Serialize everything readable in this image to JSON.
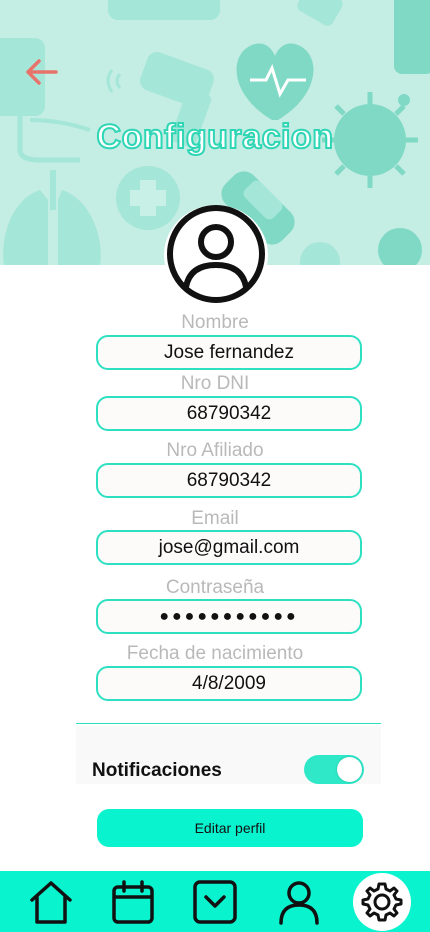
{
  "header": {
    "title": "Configuracion"
  },
  "form": {
    "fields": [
      {
        "label": "Nombre",
        "value": "Jose fernandez"
      },
      {
        "label": "Nro DNI",
        "value": "68790342"
      },
      {
        "label": "Nro Afiliado",
        "value": "68790342"
      },
      {
        "label": "Email",
        "value": "jose@gmail.com"
      },
      {
        "label": "Contraseña",
        "value": "●●●●●●●●●●●"
      },
      {
        "label": "Fecha de nacimiento",
        "value": "4/8/2009"
      }
    ]
  },
  "notifications": {
    "label": "Notificaciones",
    "enabled": true
  },
  "actions": {
    "edit_label": "Editar perfil"
  },
  "nav": {
    "items": [
      "home-icon",
      "calendar-icon",
      "inbox-icon",
      "profile-icon",
      "settings-icon"
    ],
    "active": "settings-icon"
  },
  "colors": {
    "accent": "#0af3cf",
    "border": "#2de0c2",
    "header_bg": "#c4ede4",
    "back_arrow": "#e8736b"
  }
}
